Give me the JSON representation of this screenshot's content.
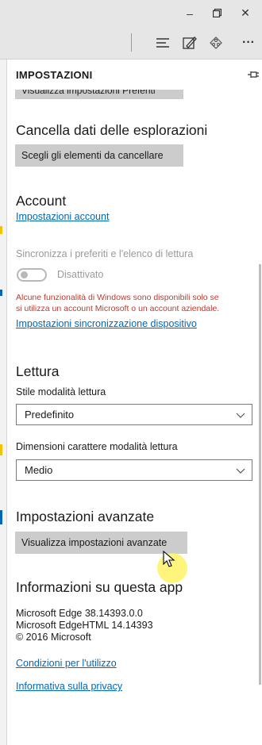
{
  "window": {
    "minimize_glyph": "–",
    "restore_glyph": "🗗",
    "close_glyph": "✕"
  },
  "toolbar": {
    "icons": [
      "hub-icon",
      "web-note-icon",
      "share-icon",
      "more-icon"
    ],
    "more_glyph": "···"
  },
  "panel": {
    "title": "IMPOSTAZIONI",
    "cut_off_button": "Visualizza impostazioni Preferiti"
  },
  "clear_data": {
    "heading": "Cancella dati delle esplorazioni",
    "button": "Scegli gli elementi da cancellare"
  },
  "account": {
    "heading": "Account",
    "settings_link": "Impostazioni account",
    "sync_label": "Sincronizza i preferiti e l'elenco di lettura",
    "toggle_state": "Disattivato",
    "warning_line1": "Alcune funzionalità di Windows sono disponibili solo se",
    "warning_line2": "si utilizza un account Microsoft o un account aziendale.",
    "device_sync_link": "Impostazioni sincronizzazione dispositivo"
  },
  "reading": {
    "heading": "Lettura",
    "style_label": "Stile modalità lettura",
    "style_value": "Predefinito",
    "font_size_label": "Dimensioni carattere modalità lettura",
    "font_size_value": "Medio"
  },
  "advanced": {
    "heading": "Impostazioni avanzate",
    "button": "Visualizza impostazioni avanzate"
  },
  "about": {
    "heading": "Informazioni su questa app",
    "line1": "Microsoft Edge 38.14393.0.0",
    "line2": "Microsoft EdgeHTML 14.14393",
    "line3": "© 2016 Microsoft",
    "terms_link": "Condizioni per l'utilizzo",
    "privacy_link": "Informativa sulla privacy"
  },
  "colors": {
    "accent_link": "#0067b8",
    "warning": "#c0392b",
    "button_bg": "#cccccc",
    "chrome_bg": "#e6e6e6"
  }
}
